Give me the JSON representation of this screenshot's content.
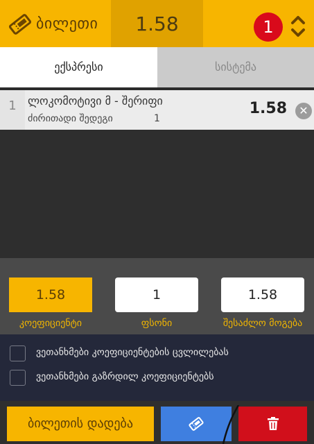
{
  "header": {
    "icon": "ticket-icon",
    "title": "ბილეთი",
    "total_odds": "1.58",
    "selections_count": "1",
    "toggle_icon": "chevrons-up-down-icon"
  },
  "tabs": [
    {
      "label": "ექსპრესი",
      "active": true
    },
    {
      "label": "სისტემა",
      "active": false
    }
  ],
  "bets": [
    {
      "index": "1",
      "match": "ლოკომოტივი მ - შერიფი",
      "market": "ძირითადი შედეგი",
      "pick": "1",
      "odds": "1.58",
      "remove_icon": "close-circle-icon"
    }
  ],
  "stake": {
    "odds_value": "1.58",
    "odds_label": "კოეფიციენტი",
    "stake_value": "1",
    "stake_label": "ფსონი",
    "win_value": "1.58",
    "win_label": "შესაძლო მოგება"
  },
  "options": [
    {
      "label": "ვეთანხმები კოეფიციენტების ცვლილებას",
      "checked": false
    },
    {
      "label": "ვეთანხმები გაზრდილ კოეფიციენტებს",
      "checked": false
    }
  ],
  "actions": {
    "place_bet_label": "ბილეთის დადება",
    "ticket_icon": "ticket-icon",
    "delete_icon": "trash-icon"
  },
  "colors": {
    "accent": "#f7b500",
    "badge": "#d90a1b",
    "ticket_button": "#3f7fe0",
    "delete_button": "#d10f1b"
  }
}
